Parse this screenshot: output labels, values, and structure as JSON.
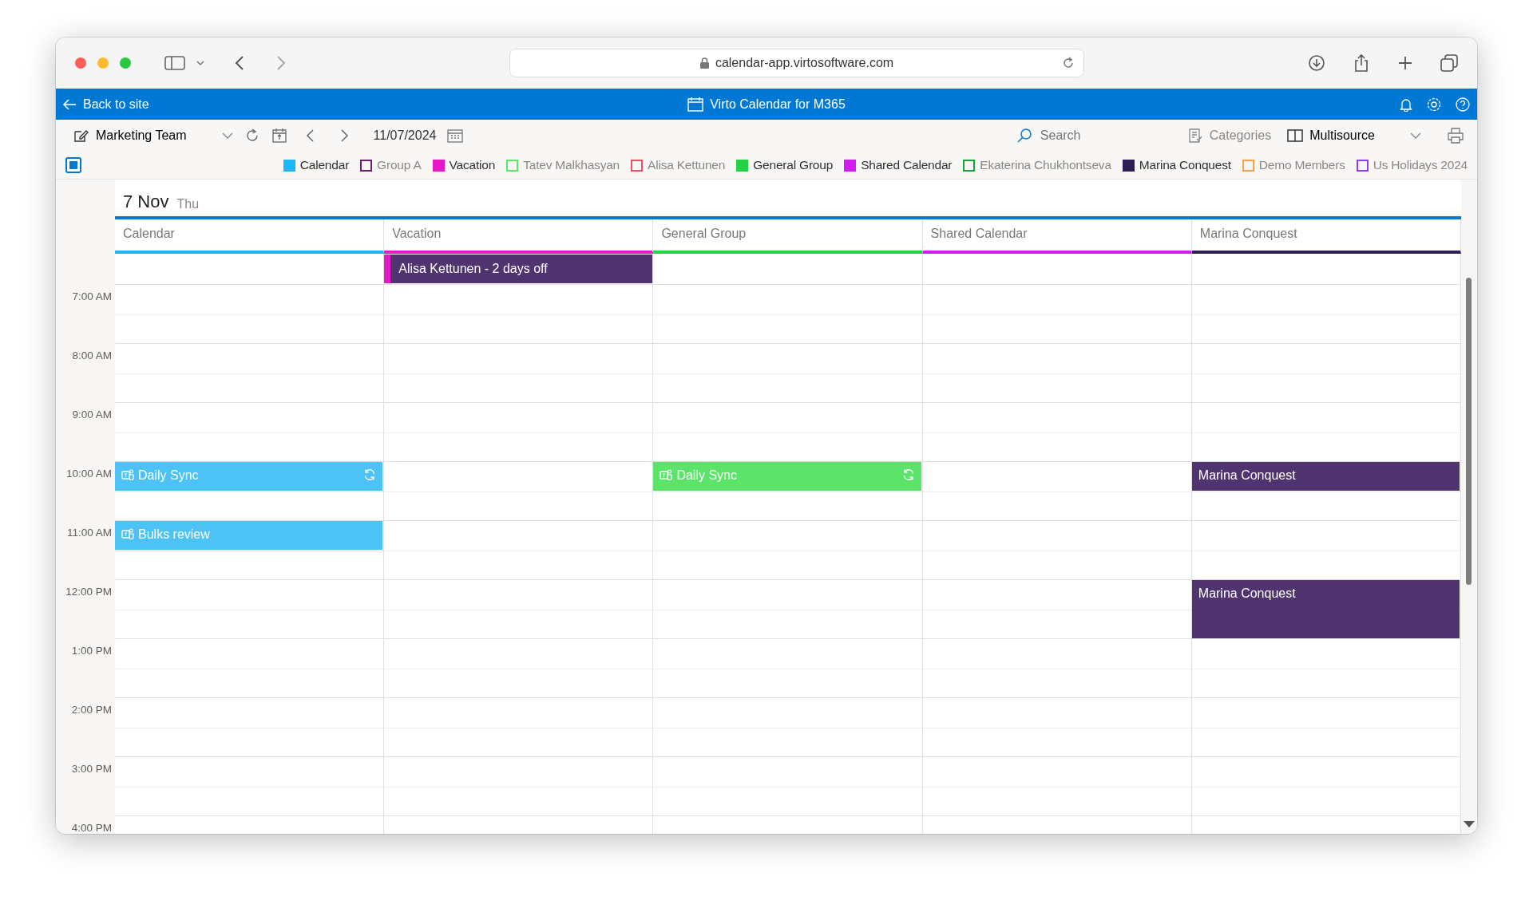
{
  "browser": {
    "url": "calendar-app.virtosoftware.com"
  },
  "app_bar": {
    "back_link": "Back to site",
    "title": "Virto Calendar for M365"
  },
  "toolbar": {
    "view_name": "Marketing Team",
    "date": "11/07/2024",
    "search_placeholder": "Search",
    "categories": "Categories",
    "mode": "Multisource"
  },
  "legend": {
    "all_checked": true,
    "items": [
      {
        "label": "Calendar",
        "color": "#1fb6f5",
        "checked": true
      },
      {
        "label": "Group A",
        "color": "#6b1f6e",
        "checked": false
      },
      {
        "label": "Vacation",
        "color": "#e619c6",
        "checked": true
      },
      {
        "label": "Tatev Malkhasyan",
        "color": "#5ce46a",
        "checked": false
      },
      {
        "label": "Alisa Kettunen",
        "color": "#e8535d",
        "checked": false
      },
      {
        "label": "General Group",
        "color": "#22d445",
        "checked": true
      },
      {
        "label": "Shared Calendar",
        "color": "#d21df0",
        "checked": true
      },
      {
        "label": "Ekaterina Chukhontseva",
        "color": "#19a23a",
        "checked": false
      },
      {
        "label": "Marina Conquest",
        "color": "#2f1e55",
        "checked": true
      },
      {
        "label": "Demo Members",
        "color": "#f5a04a",
        "checked": false
      },
      {
        "label": "Us Holidays 2024",
        "color": "#8f3df0",
        "checked": false
      }
    ]
  },
  "day": {
    "date": "7 Nov",
    "weekday": "Thu"
  },
  "columns": [
    {
      "name": "Calendar",
      "color": "#1fb6f5"
    },
    {
      "name": "Vacation",
      "color": "#e619c6",
      "all_day": [
        {
          "title": "Alisa Kettunen - 2 days off",
          "color": "#4f3470"
        }
      ]
    },
    {
      "name": "General Group",
      "color": "#22d445"
    },
    {
      "name": "Shared Calendar",
      "color": "#d21df0"
    },
    {
      "name": "Marina Conquest",
      "color": "#2f1e55"
    }
  ],
  "hours": [
    {
      "label": "7:00 AM"
    },
    {
      "label": "8:00 AM"
    },
    {
      "label": "9:00 AM"
    },
    {
      "label": "10:00 AM",
      "cells": [
        {
          "kind": "short",
          "title": "Daily Sync",
          "teams": true,
          "recurring": true,
          "color": "#4cc2f5"
        },
        {
          "kind": "empty"
        },
        {
          "kind": "short",
          "title": "Daily Sync",
          "teams": true,
          "recurring": true,
          "color": "#5ce46a"
        },
        {
          "kind": "empty"
        },
        {
          "kind": "short",
          "title": "Marina Conquest",
          "teams": false,
          "recurring": false,
          "color": "#4f3470"
        }
      ]
    },
    {
      "label": "11:00 AM",
      "cells": [
        {
          "kind": "short",
          "title": "Bulks review",
          "teams": true,
          "recurring": false,
          "color": "#4cc2f5"
        },
        {
          "kind": "empty"
        },
        {
          "kind": "empty"
        },
        {
          "kind": "empty"
        },
        {
          "kind": "empty"
        }
      ]
    },
    {
      "label": "12:00 PM",
      "cells": [
        {
          "kind": "empty"
        },
        {
          "kind": "empty"
        },
        {
          "kind": "empty"
        },
        {
          "kind": "empty"
        },
        {
          "kind": "long",
          "title": "Marina Conquest",
          "teams": false,
          "recurring": false,
          "color": "#4f3470"
        }
      ]
    },
    {
      "label": "1:00 PM"
    },
    {
      "label": "2:00 PM"
    },
    {
      "label": "3:00 PM"
    },
    {
      "label": "4:00 PM"
    }
  ]
}
